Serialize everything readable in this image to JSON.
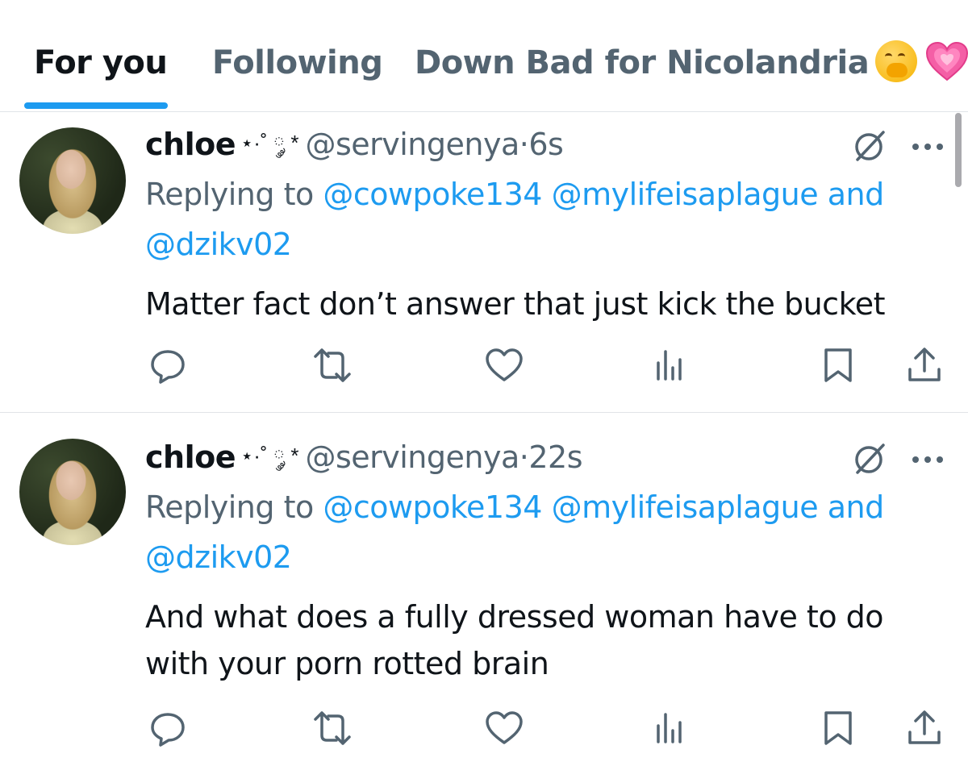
{
  "tabs": [
    {
      "label": "For you",
      "active": true
    },
    {
      "label": "Following",
      "active": false
    },
    {
      "label": "Down Bad for Nicolandria",
      "active": false
    }
  ],
  "tab_emojis": [
    "face-with-hand-over-mouth-emoji",
    "growing-heart-emoji"
  ],
  "colors": {
    "accent": "#1d9bf0",
    "text_primary": "#0f1419",
    "text_secondary": "#536471",
    "divider": "#e1e4e8"
  },
  "tweets": [
    {
      "name": "chloe",
      "name_decoration": "⋆·˚ ༘ *",
      "handle": "@servingenya",
      "separator": "·",
      "time": "6s",
      "replying_prefix": "Replying to ",
      "mention_1": "@cowpoke134",
      "mention_2": "@mylifeisaplague",
      "and_word": "and",
      "mention_3": "@dzikv02",
      "body": "Matter fact don’t answer that just kick the bucket"
    },
    {
      "name": "chloe",
      "name_decoration": "⋆·˚ ༘ *",
      "handle": "@servingenya",
      "separator": "·",
      "time": "22s",
      "replying_prefix": "Replying to ",
      "mention_1": "@cowpoke134",
      "mention_2": "@mylifeisaplague",
      "and_word": "and",
      "mention_3": "@dzikv02",
      "body": "And what does a fully dressed woman have to do with your porn rotted brain"
    }
  ],
  "action_icons": [
    "reply-icon",
    "retweet-icon",
    "like-icon",
    "views-icon",
    "bookmark-icon",
    "share-icon"
  ]
}
